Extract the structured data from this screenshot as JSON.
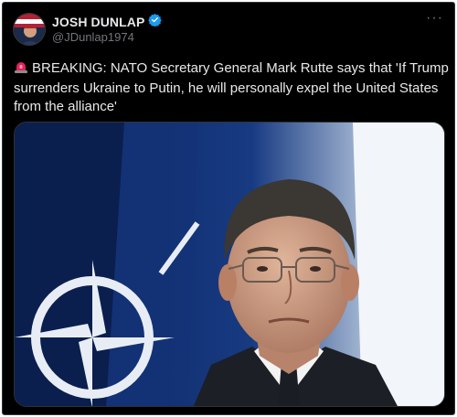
{
  "post": {
    "display_name": "JOSH DUNLAP",
    "handle": "@JDunlap1974",
    "verified": true,
    "more_label": "···",
    "text": "BREAKING: NATO Secretary General Mark Rutte says that 'If Trump surrenders Ukraine to Putin, he will personally expel the United States from the alliance'",
    "prefix_icon": "rotating-light-icon"
  },
  "colors": {
    "background": "#000000",
    "text": "#e7e9ea",
    "muted": "#71767b",
    "verified": "#1d9bf0",
    "siren": "#e0245e"
  }
}
